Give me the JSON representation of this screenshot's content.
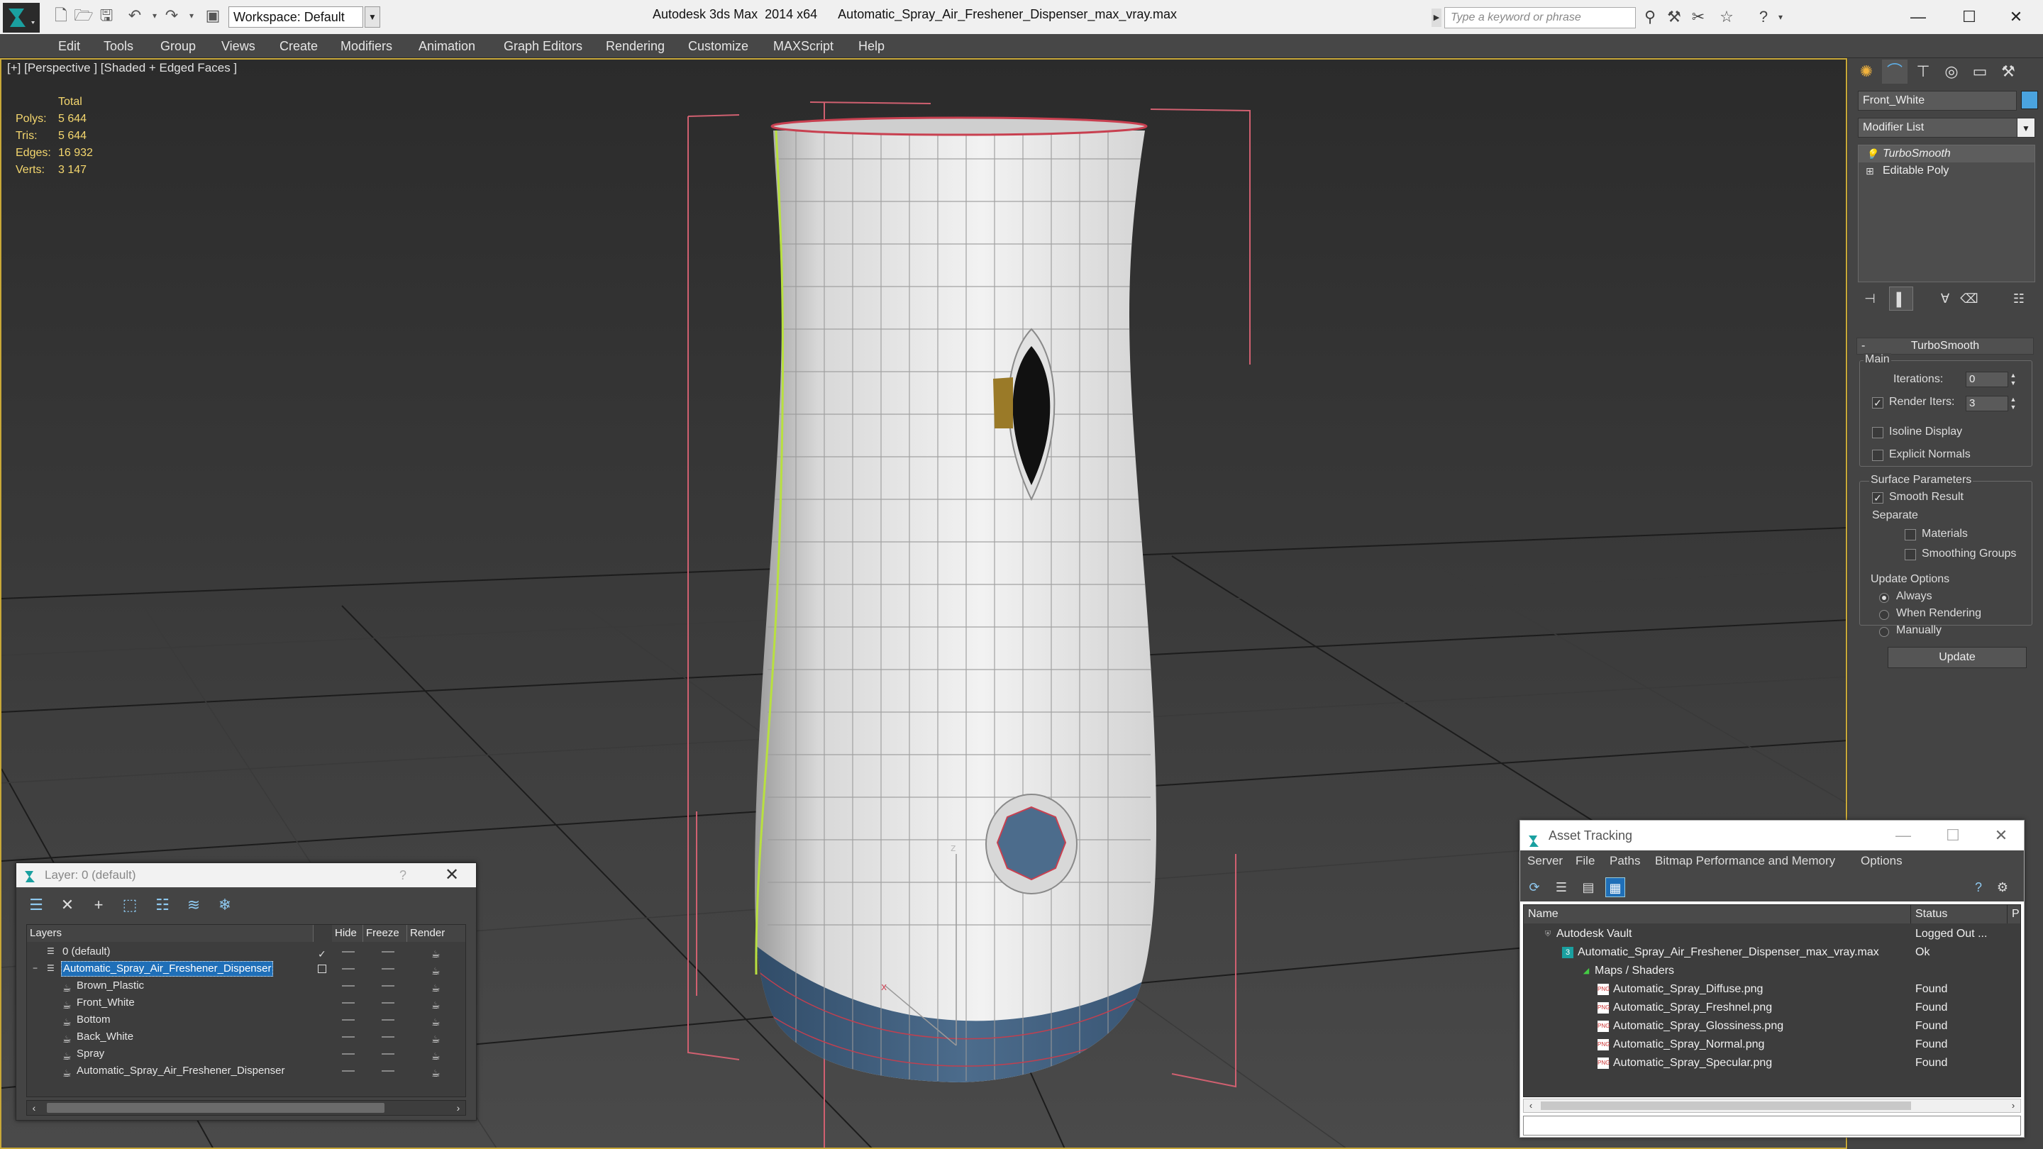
{
  "titlebar": {
    "workspace": "Workspace: Default",
    "app_title": "Autodesk 3ds Max  2014 x64",
    "file_name": "Automatic_Spray_Air_Freshener_Dispenser_max_vray.max",
    "search_placeholder": "Type a keyword or phrase"
  },
  "menu": [
    "Edit",
    "Tools",
    "Group",
    "Views",
    "Create",
    "Modifiers",
    "Animation",
    "Graph Editors",
    "Rendering",
    "Customize",
    "MAXScript",
    "Help"
  ],
  "viewport": {
    "label": "[+] [Perspective ] [Shaded + Edged Faces ]",
    "stats": {
      "header": "Total",
      "rows": [
        {
          "key": "Polys:",
          "value": "5 644"
        },
        {
          "key": "Tris:",
          "value": "5 644"
        },
        {
          "key": "Edges:",
          "value": "16 932"
        },
        {
          "key": "Verts:",
          "value": "3 147"
        }
      ]
    },
    "gizmo_x": "x",
    "gizmo_z": "z"
  },
  "command_panel": {
    "object_name": "Front_White",
    "object_color": "#4aa3df",
    "modifier_list": "Modifier List",
    "stack": [
      "TurboSmooth",
      "Editable Poly"
    ],
    "rollout_title": "TurboSmooth",
    "main_label": "Main",
    "iterations_label": "Iterations:",
    "iterations_value": "0",
    "render_iters_label": "Render Iters:",
    "render_iters_value": "3",
    "render_iters_checked": true,
    "isoline_label": "Isoline Display",
    "explicit_normals_label": "Explicit Normals",
    "surface_params_label": "Surface Parameters",
    "smooth_result_label": "Smooth Result",
    "separate_label": "Separate",
    "materials_label": "Materials",
    "smoothing_groups_label": "Smoothing Groups",
    "update_options_label": "Update Options",
    "radio_always": "Always",
    "radio_when_rendering": "When Rendering",
    "radio_manually": "Manually",
    "update_button": "Update"
  },
  "layer_window": {
    "title": "Layer: 0 (default)",
    "help": "?",
    "columns": {
      "layers": "Layers",
      "hide": "Hide",
      "freeze": "Freeze",
      "render": "Render"
    },
    "rows": [
      {
        "name": "0 (default)",
        "level": 0,
        "type": "layer"
      },
      {
        "name": "Automatic_Spray_Air_Freshener_Dispenser",
        "level": 0,
        "type": "layer",
        "selected": true
      },
      {
        "name": "Brown_Plastic",
        "level": 1,
        "type": "object"
      },
      {
        "name": "Front_White",
        "level": 1,
        "type": "object"
      },
      {
        "name": "Bottom",
        "level": 1,
        "type": "object"
      },
      {
        "name": "Back_White",
        "level": 1,
        "type": "object"
      },
      {
        "name": "Spray",
        "level": 1,
        "type": "object"
      },
      {
        "name": "Automatic_Spray_Air_Freshener_Dispenser",
        "level": 1,
        "type": "object"
      }
    ]
  },
  "asset_tracking": {
    "title": "Asset Tracking",
    "menu": [
      "Server",
      "File",
      "Paths",
      "Bitmap Performance and Memory",
      "Options"
    ],
    "columns": {
      "name": "Name",
      "status": "Status",
      "p": "P"
    },
    "rows": [
      {
        "name": "Autodesk Vault",
        "status": "Logged Out ...",
        "level": 0,
        "icon": "vault"
      },
      {
        "name": "Automatic_Spray_Air_Freshener_Dispenser_max_vray.max",
        "status": "Ok",
        "level": 1,
        "icon": "max"
      },
      {
        "name": "Maps / Shaders",
        "status": "",
        "level": 2,
        "icon": "folder"
      },
      {
        "name": "Automatic_Spray_Diffuse.png",
        "status": "Found",
        "level": 3,
        "icon": "png"
      },
      {
        "name": "Automatic_Spray_Freshnel.png",
        "status": "Found",
        "level": 3,
        "icon": "png"
      },
      {
        "name": "Automatic_Spray_Glossiness.png",
        "status": "Found",
        "level": 3,
        "icon": "png"
      },
      {
        "name": "Automatic_Spray_Normal.png",
        "status": "Found",
        "level": 3,
        "icon": "png"
      },
      {
        "name": "Automatic_Spray_Specular.png",
        "status": "Found",
        "level": 3,
        "icon": "png"
      }
    ]
  }
}
